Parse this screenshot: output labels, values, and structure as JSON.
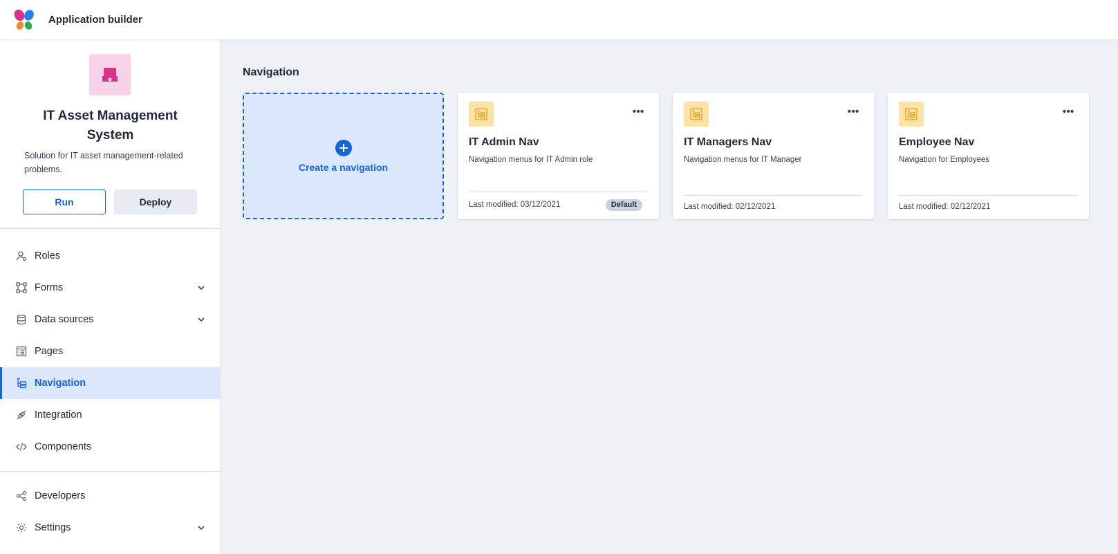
{
  "header": {
    "title": "Application builder"
  },
  "app": {
    "name": "IT Asset Management System",
    "description": "Solution for IT asset management-related problems.",
    "run_label": "Run",
    "deploy_label": "Deploy"
  },
  "sidebar": {
    "items": [
      {
        "label": "Roles",
        "icon": "roles-icon",
        "expandable": false,
        "active": false
      },
      {
        "label": "Forms",
        "icon": "forms-icon",
        "expandable": true,
        "active": false
      },
      {
        "label": "Data sources",
        "icon": "database-icon",
        "expandable": true,
        "active": false
      },
      {
        "label": "Pages",
        "icon": "pages-icon",
        "expandable": false,
        "active": false
      },
      {
        "label": "Navigation",
        "icon": "navigation-icon",
        "expandable": false,
        "active": true
      },
      {
        "label": "Integration",
        "icon": "integration-icon",
        "expandable": false,
        "active": false
      },
      {
        "label": "Components",
        "icon": "code-icon",
        "expandable": false,
        "active": false
      }
    ],
    "bottom_items": [
      {
        "label": "Developers",
        "icon": "developers-icon",
        "expandable": false
      },
      {
        "label": "Settings",
        "icon": "gear-icon",
        "expandable": true
      }
    ]
  },
  "main": {
    "section_title": "Navigation",
    "create_label": "Create a navigation",
    "cards": [
      {
        "title": "IT Admin Nav",
        "description": "Navigation menus for IT Admin role",
        "modified": "Last modified: 03/12/2021",
        "badge": "Default"
      },
      {
        "title": "IT Managers Nav",
        "description": "Navigation menus for IT Manager",
        "modified": "Last modified: 02/12/2021",
        "badge": null
      },
      {
        "title": "Employee Nav",
        "description": "Navigation for Employees",
        "modified": "Last modified: 02/12/2021",
        "badge": null
      }
    ]
  },
  "colors": {
    "accent": "#1565d8",
    "active_bg": "#dbe7fb",
    "app_icon_bg": "#f9d3e8",
    "app_icon_fg": "#d6338a",
    "card_icon_bg": "#fde3a3",
    "card_icon_fg": "#e0a020",
    "page_bg": "#eef2f7"
  }
}
